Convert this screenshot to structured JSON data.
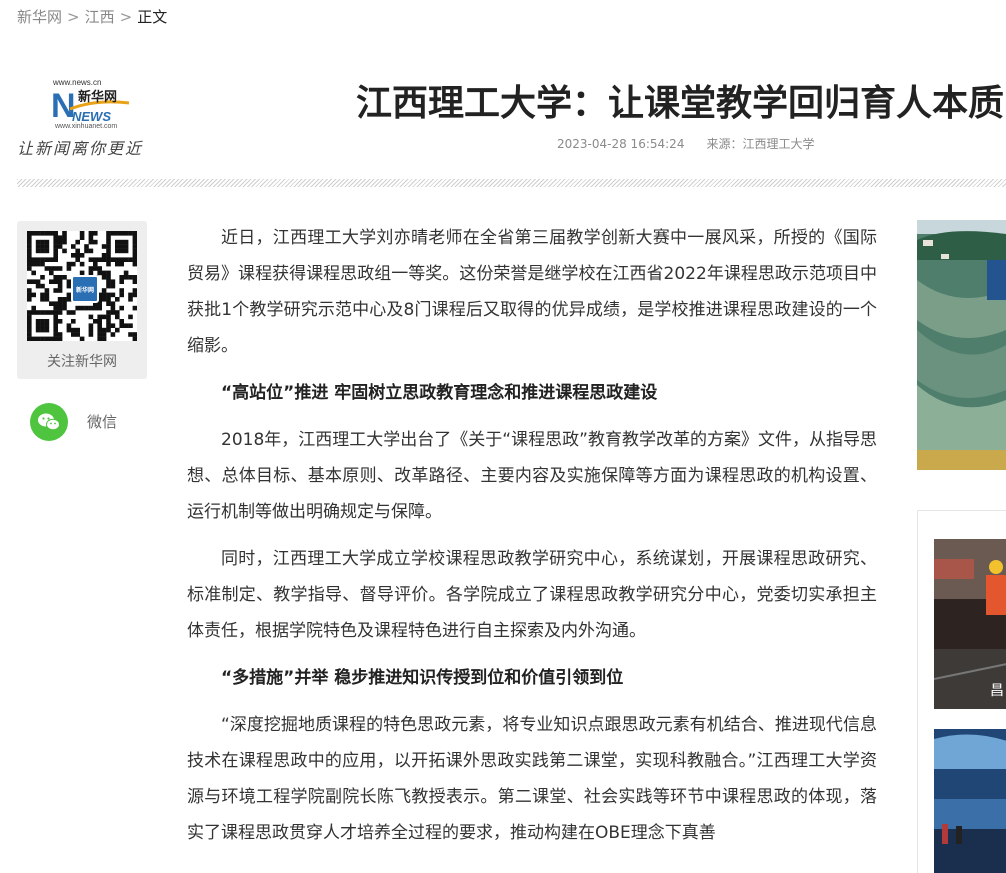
{
  "breadcrumb": {
    "items": [
      "新华网",
      "江西"
    ],
    "separator": ">",
    "current": "正文"
  },
  "logo": {
    "url_top": "www.news.cn",
    "brand_cn": "新华网",
    "brand_en": "NEWS",
    "url_bottom": "www.xinhuanet.com",
    "slogan": "让新闻离你更近"
  },
  "article": {
    "title": "江西理工大学：让课堂教学回归育人本质",
    "datetime": "2023-04-28 16:54:24",
    "source_label": "来源：",
    "source": "江西理工大学",
    "paragraphs": [
      {
        "type": "text",
        "text": "近日，江西理工大学刘亦晴老师在全省第三届教学创新大赛中一展风采，所授的《国际贸易》课程获得课程思政组一等奖。这份荣誉是继学校在江西省2022年课程思政示范项目中获批1个教学研究示范中心及8门课程后又取得的优异成绩，是学校推进课程思政建设的一个缩影。"
      },
      {
        "type": "subhead",
        "text": "“高站位”推进 牢固树立思政教育理念和推进课程思政建设"
      },
      {
        "type": "text",
        "text": "2018年，江西理工大学出台了《关于“课程思政”教育教学改革的方案》文件，从指导思想、总体目标、基本原则、改革路径、主要内容及实施保障等方面为课程思政的机构设置、运行机制等做出明确规定与保障。"
      },
      {
        "type": "text",
        "text": "同时，江西理工大学成立学校课程思政教学研究中心，系统谋划，开展课程思政研究、标准制定、教学指导、督导评价。各学院成立了课程思政教学研究分中心，党委切实承担主体责任，根据学院特色及课程特色进行自主探索及内外沟通。"
      },
      {
        "type": "subhead",
        "text": "“多措施”并举 稳步推进知识传授到位和价值引领到位"
      },
      {
        "type": "text",
        "text": "“深度挖掘地质课程的特色思政元素，将专业知识点跟思政元素有机结合、推进现代信息技术在课程思政中的应用，以开拓课外思政实践第二课堂，实现科教融合。”江西理工大学资源与环境工程学院副院长陈飞教授表示。第二课堂、社会实践等环节中课程思政的体现，落实了课程思政贯穿人才培养全过程的要求，推动构建在OBE理念下真善"
      }
    ]
  },
  "share": {
    "qr_badge_text": "新华网",
    "qr_label": "关注新华网",
    "wechat_label": "微信"
  },
  "sidebar": {
    "thumb1_caption": "昌"
  },
  "colors": {
    "wechat_green": "#4ec43f",
    "brand_blue": "#2a6fb4",
    "brand_gold": "#e8a317"
  }
}
